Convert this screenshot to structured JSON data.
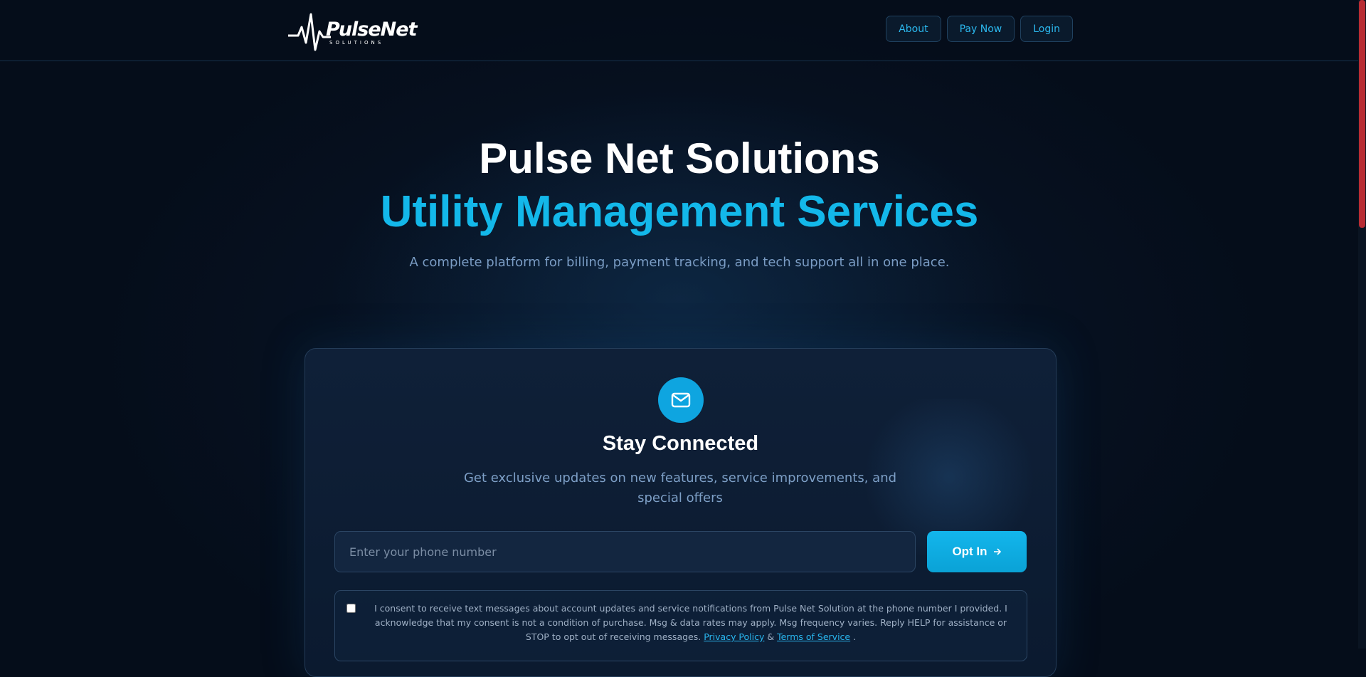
{
  "header": {
    "logo": {
      "name": "PulseNet",
      "sub": "SOLUTIONS"
    },
    "nav": [
      {
        "label": "About"
      },
      {
        "label": "Pay Now"
      },
      {
        "label": "Login"
      }
    ]
  },
  "hero": {
    "title_line1": "Pulse Net Solutions",
    "title_line2": "Utility Management Services",
    "subtitle": "A complete platform for billing, payment tracking, and tech support all in one place."
  },
  "signup": {
    "icon": "mail-icon",
    "title": "Stay Connected",
    "description": "Get exclusive updates on new features, service improvements, and special offers",
    "phone_placeholder": "Enter your phone number",
    "phone_value": "",
    "button_label": "Opt In",
    "button_icon": "arrow-right-icon",
    "consent": {
      "checked": false,
      "text": "I consent to receive text messages about account updates and service notifications from Pulse Net Solution at the phone number I provided. I acknowledge that my consent is not a condition of purchase. Msg & data rates may apply. Msg frequency varies. Reply HELP for assistance or STOP to opt out of receiving messages.",
      "privacy_link": "Privacy Policy",
      "ampersand": "&",
      "terms_link": "Terms of Service",
      "end": "."
    }
  },
  "colors": {
    "accent": "#13b8ea",
    "background": "#050d1a",
    "card": "#0f2038"
  }
}
